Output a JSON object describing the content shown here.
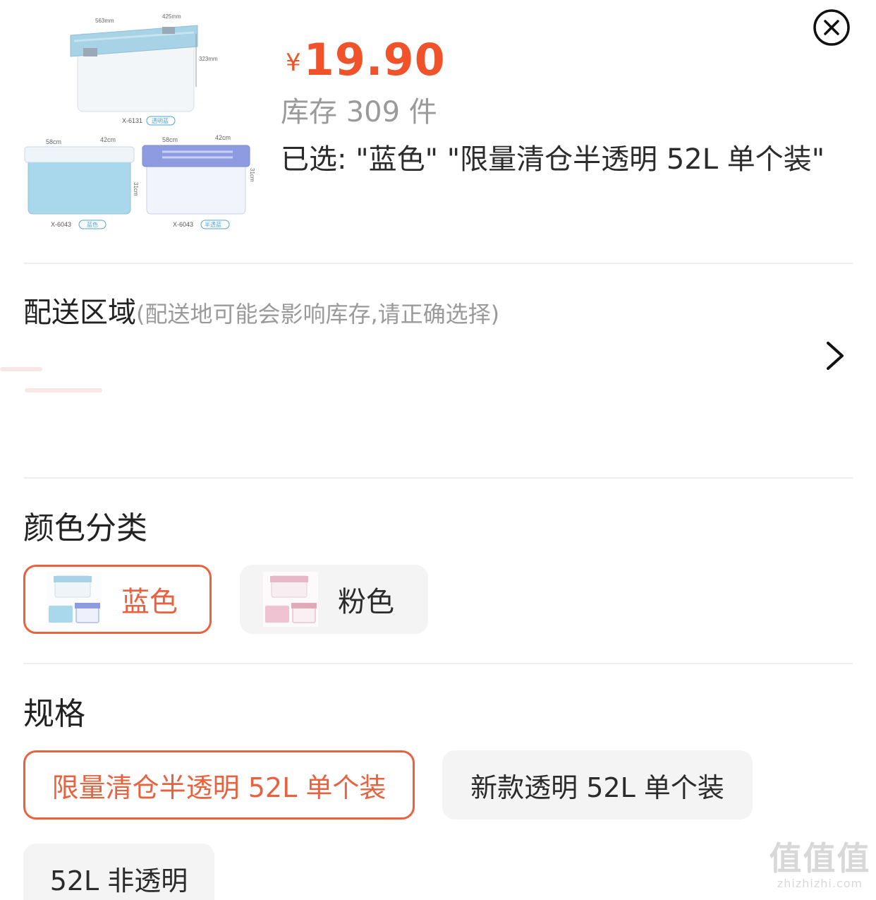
{
  "header": {
    "currency": "¥",
    "price": "19.90",
    "stock": "库存 309 件",
    "selected": "已选: \"蓝色\" \"限量清仓半透明 52L 单个装\""
  },
  "product_image": {
    "top_model": "X-6131",
    "top_tag": "透明蓝",
    "top_dims": [
      "563mm",
      "425mm",
      "323mm"
    ],
    "left_model": "X-6043",
    "left_tag": "蓝色",
    "left_dims": [
      "58cm",
      "42cm",
      "31cm"
    ],
    "right_model": "X-6043",
    "right_tag": "半透蓝",
    "right_dims": [
      "58cm",
      "42cm",
      "31cm"
    ]
  },
  "delivery": {
    "title": "配送区域",
    "hint": "(配送地可能会影响库存,请正确选择)"
  },
  "color_section": {
    "title": "颜色分类",
    "options": [
      {
        "label": "蓝色",
        "selected": true
      },
      {
        "label": "粉色",
        "selected": false
      }
    ]
  },
  "spec_section": {
    "title": "规格",
    "options": [
      {
        "label": "限量清仓半透明 52L 单个装",
        "selected": true
      },
      {
        "label": "新款透明 52L 单个装",
        "selected": false
      },
      {
        "label": "52L 非透明",
        "selected": false
      }
    ]
  },
  "watermark": {
    "big": "值值值",
    "small": "zhizhizhi.com"
  },
  "colors": {
    "accent": "#f0532a",
    "selected_border": "#e8623f",
    "muted_text": "#9a9a9a",
    "chip_bg": "#f4f4f4"
  },
  "icons": [
    "close-circle-icon",
    "chevron-right-icon"
  ]
}
